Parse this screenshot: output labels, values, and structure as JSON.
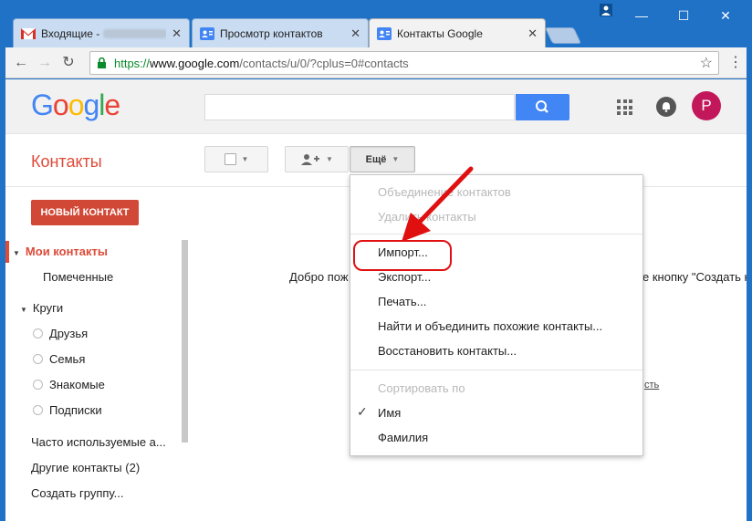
{
  "tabs": [
    {
      "label": "Входящие -",
      "icon": "gmail-icon"
    },
    {
      "label": "Просмотр контактов",
      "icon": "contacts-icon"
    },
    {
      "label": "Контакты Google",
      "icon": "contacts-icon",
      "active": true
    }
  ],
  "address": {
    "scheme": "https://",
    "host": "www.google.com",
    "path": "/contacts/u/0/?cplus=0#contacts"
  },
  "google": {
    "logo": "Google",
    "avatar_letter": "P",
    "avatar_color": "#c2185b"
  },
  "toolbar": {
    "title": "Контакты",
    "more_label": "Ещё"
  },
  "sidebar": {
    "new_contact": "НОВЫЙ КОНТАКТ",
    "my_contacts": "Мои контакты",
    "starred": "Помеченные",
    "circles": "Круги",
    "circle_items": [
      "Друзья",
      "Семья",
      "Знакомые",
      "Подписки"
    ],
    "frequent": "Часто используемые а...",
    "other": "Другие контакты (2)",
    "create_group": "Создать группу..."
  },
  "main": {
    "welcome_left": "Добро пож",
    "welcome_right": "е кнопку \"Создать к",
    "link_fragment": "сть"
  },
  "menu": {
    "merge": "Объединение контактов",
    "delete": "Удалить контакты",
    "import": "Импорт...",
    "export": "Экспорт...",
    "print": "Печать...",
    "find_merge": "Найти и объединить похожие контакты...",
    "restore": "Восстановить контакты...",
    "sort_by": "Сортировать по",
    "sort_name": "Имя",
    "sort_surname": "Фамилия"
  },
  "colors": {
    "accent_red": "#dd4b39",
    "button_red": "#d14836",
    "search_blue": "#4285f4",
    "annotation_red": "#e01010"
  }
}
